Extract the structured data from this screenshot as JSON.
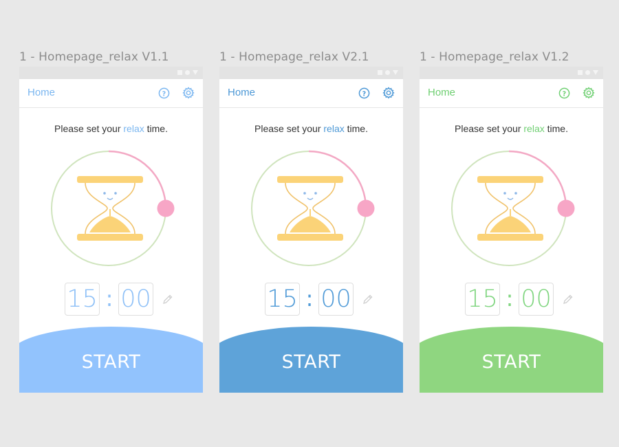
{
  "frames": [
    {
      "title": "1 - Homepage_relax V1.1",
      "home": "Home",
      "prompt_before": "Please set your ",
      "prompt_highlight": "relax",
      "prompt_after": " time.",
      "minutes": "15",
      "colon": ":",
      "seconds": "00",
      "start": "START",
      "accent": "#7ab6f0",
      "digit_color": "#8ec0f7",
      "button_color": "#92c3fd",
      "icons": [
        "help-icon",
        "gear-icon",
        "hourglass-icon",
        "pencil-icon"
      ]
    },
    {
      "title": "1 - Homepage_relax V2.1",
      "home": "Home",
      "prompt_before": "Please set your ",
      "prompt_highlight": "relax",
      "prompt_after": " time.",
      "minutes": "15",
      "colon": ":",
      "seconds": "00",
      "start": "START",
      "accent": "#4c98d6",
      "digit_color": "#4f9ad7",
      "button_color": "#5ea3d9",
      "icons": [
        "help-icon",
        "gear-icon",
        "hourglass-icon",
        "pencil-icon"
      ]
    },
    {
      "title": "1 - Homepage_relax V1.2",
      "home": "Home",
      "prompt_before": "Please set your ",
      "prompt_highlight": "relax",
      "prompt_after": " time.",
      "minutes": "15",
      "colon": ":",
      "seconds": "00",
      "start": "START",
      "accent": "#6fcf72",
      "digit_color": "#7fd57f",
      "button_color": "#8fd680",
      "icons": [
        "help-icon",
        "gear-icon",
        "hourglass-icon",
        "pencil-icon"
      ]
    }
  ],
  "dial_colors": {
    "ring": "#cfe4bd",
    "progress": "#f3a8c4",
    "knob": "#f7a6c6",
    "sand": "#fbd378",
    "outline": "#f0c26a",
    "face": "#8bb6e8"
  }
}
